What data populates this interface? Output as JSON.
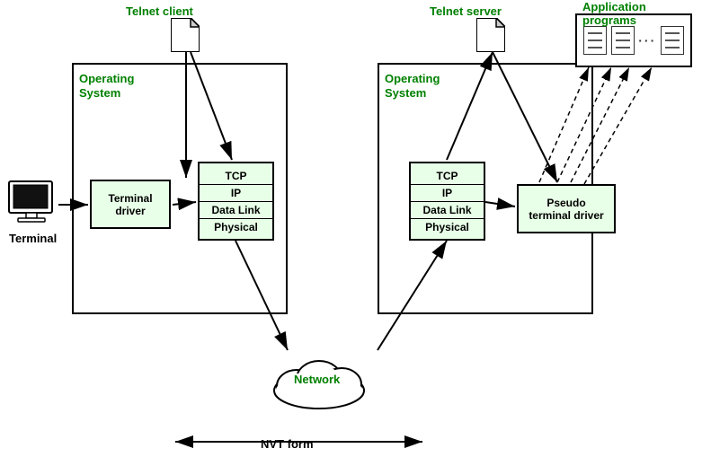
{
  "labels": {
    "telnet_client": "Telnet client",
    "telnet_server": "Telnet server",
    "application_programs_line1": "Application",
    "application_programs_line2": "programs",
    "operating_system_left": "Operating\nSystem",
    "operating_system_right": "Operating\nSystem",
    "terminal_driver": "Terminal\ndriver",
    "pseudo_terminal_driver_line1": "Pseudo",
    "pseudo_terminal_driver_line2": "terminal driver",
    "terminal": "Terminal",
    "network": "Network",
    "nvt_form": "NVT form",
    "tcp": "TCP",
    "ip": "IP",
    "data_link": "Data Link",
    "physical": "Physical"
  },
  "colors": {
    "green": "#008000",
    "black": "#000000",
    "box_fill": "#e8ffe8",
    "white": "#ffffff"
  }
}
